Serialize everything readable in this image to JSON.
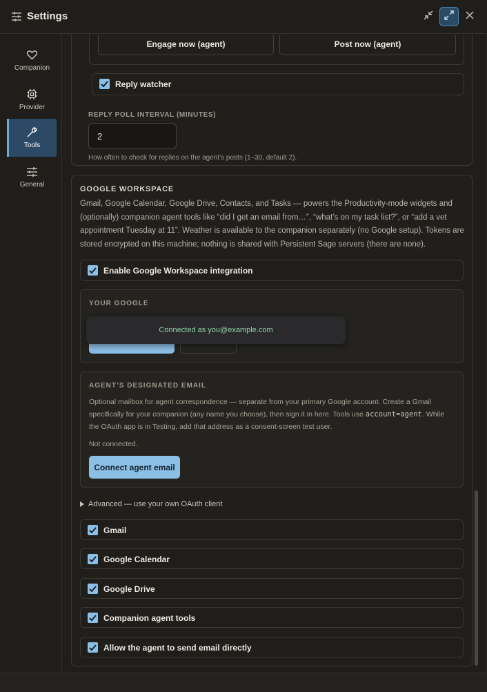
{
  "window": {
    "title": "Settings"
  },
  "titlebar_icons": [
    "sliders-icon",
    "collapse-icon",
    "expand-icon",
    "close-icon"
  ],
  "sidebar": {
    "items": [
      {
        "label": "Companion",
        "icon": "heart-icon",
        "active": false
      },
      {
        "label": "Provider",
        "icon": "chip-icon",
        "active": false
      },
      {
        "label": "Tools",
        "icon": "wrench-icon",
        "active": true
      },
      {
        "label": "General",
        "icon": "sliders-icon",
        "active": false
      }
    ]
  },
  "top_card": {
    "engage_label": "Engage now (agent)",
    "post_label": "Post now (agent)",
    "reply_watcher": {
      "label": "Reply watcher",
      "checked": true
    },
    "poll_interval": {
      "label": "REPLY POLL INTERVAL (MINUTES)",
      "value": "2",
      "help": "How often to check for replies on the agent’s posts (1–30, default 2)."
    }
  },
  "google": {
    "title": "GOOGLE WORKSPACE",
    "description": "Gmail, Google Calendar, Google Drive, Contacts, and Tasks — powers the Productivity-mode widgets and (optionally) companion agent tools like “did I get an email from…”, “what’s on my task list?”, or “add a vet appointment Tuesday at 11”. Weather is available to the companion separately (no Google setup). Tokens are stored encrypted on this machine; nothing is shared with Persistent Sage servers (there are none).",
    "enable": {
      "label": "Enable Google Workspace integration",
      "checked": true
    },
    "your_google": {
      "label": "YOUR GOOGLE",
      "toast": "Connected as you@example.com"
    },
    "agent_email": {
      "label": "AGENT’S DESIGNATED EMAIL",
      "desc_1": "Optional mailbox for agent correspondence — separate from your primary Google account. Create a Gmail specifically for your companion (any name you choose), then sign it in here. Tools use ",
      "desc_code": "account=agent",
      "desc_2": ". While the OAuth app is in Testing, add that address as a consent-screen test user.",
      "status": "Not connected.",
      "button": "Connect agent email"
    },
    "advanced": "Advanced — use your own OAuth client",
    "services": [
      {
        "label": "Gmail",
        "checked": true
      },
      {
        "label": "Google Calendar",
        "checked": true
      },
      {
        "label": "Google Drive",
        "checked": true
      },
      {
        "label": "Companion agent tools",
        "checked": true
      },
      {
        "label": "Allow the agent to send email directly",
        "checked": true
      }
    ]
  },
  "colors": {
    "accent": "#8cbfe6",
    "active_nav": "#2c4a66",
    "success_text": "#8fd4a6"
  }
}
